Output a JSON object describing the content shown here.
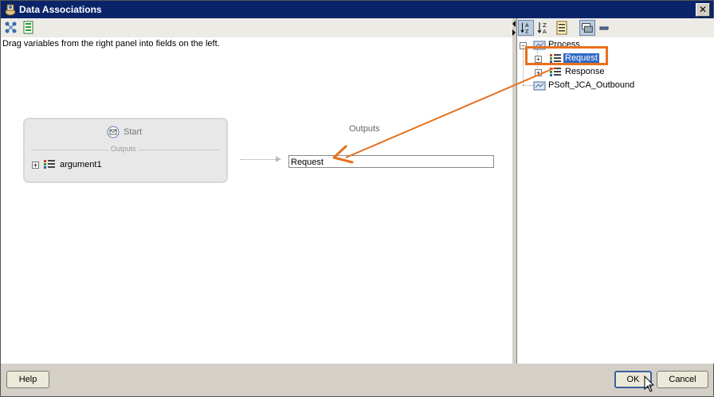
{
  "window": {
    "title": "Data Associations",
    "close_label": "✕"
  },
  "left": {
    "instruction": "Drag variables from the right panel into fields on the left.",
    "start": {
      "label": "Start",
      "outputs_label": "Outputs",
      "argument": "argument1"
    },
    "outputs_header": "Outputs",
    "output_field_value": "Request"
  },
  "tree": {
    "root": "Process",
    "children": [
      "Request",
      "Response"
    ],
    "sibling": "PSoft_JCA_Outbound",
    "selected": "Request"
  },
  "buttons": {
    "help": "Help",
    "ok": "OK",
    "cancel": "Cancel"
  },
  "colors": {
    "titlebar": "#0a246a",
    "annotation": "#e8701e",
    "selection": "#316ac5"
  },
  "icons": [
    "process-icon",
    "tree-icon",
    "variable-icon",
    "start-envelope-icon",
    "sort-asc-icon",
    "sort-desc-icon",
    "list-icon",
    "collapse-icon",
    "minus-icon",
    "mouse-cursor-icon"
  ]
}
